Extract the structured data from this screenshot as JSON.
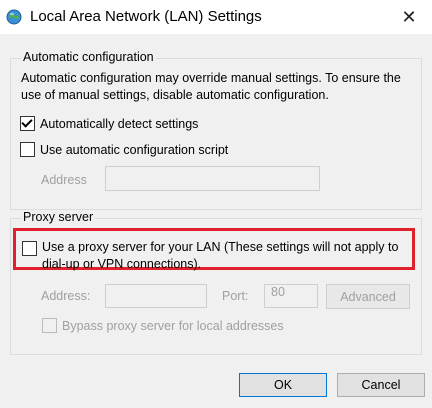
{
  "window": {
    "title": "Local Area Network (LAN) Settings",
    "close_glyph": "✕"
  },
  "auto_config": {
    "legend": "Automatic configuration",
    "description": "Automatic configuration may override manual settings.  To ensure the use of manual settings, disable automatic configuration.",
    "detect_label": "Automatically detect settings",
    "detect_checked": true,
    "script_label": "Use automatic configuration script",
    "script_checked": false,
    "address_label": "Address",
    "address_value": ""
  },
  "proxy": {
    "legend": "Proxy server",
    "use_proxy_label_line1": "Use a proxy server for your LAN (These settings will not apply to",
    "use_proxy_label_line2": "dial-up or VPN connections).",
    "use_proxy_checked": false,
    "address_label": "Address:",
    "address_value": "",
    "port_label": "Port:",
    "port_value": "80",
    "advanced_label": "Advanced",
    "bypass_label": "Bypass proxy server for local addresses",
    "bypass_checked": false
  },
  "buttons": {
    "ok": "OK",
    "cancel": "Cancel"
  },
  "colors": {
    "highlight": "#e0202d",
    "dialog_bg": "#f0f0f0",
    "primary_border": "#0078d7"
  },
  "icons": {
    "title": "network-globe-icon",
    "close": "close-icon",
    "checkmark": "checkmark-icon"
  }
}
